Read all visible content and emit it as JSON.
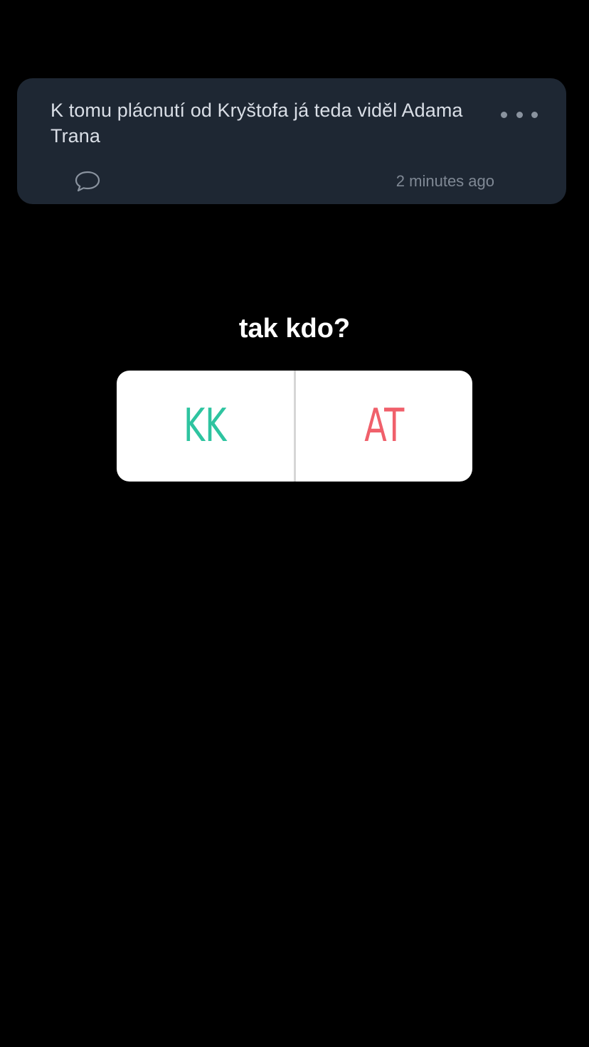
{
  "post": {
    "text": "K tomu plácnutí od Kryštofa já teda viděl Adama Trana",
    "timestamp": "2 minutes ago",
    "icons": {
      "more": "more-horizontal-icon",
      "comment": "comment-bubble-icon"
    }
  },
  "poll": {
    "question": "tak kdo?",
    "options": [
      {
        "label": "KK",
        "color": "#2ec4a0"
      },
      {
        "label": "AT",
        "color": "#f0606b"
      }
    ]
  },
  "colors": {
    "background": "#000000",
    "card": "#1e2733",
    "post_text": "#d9dee6",
    "muted": "#7f8894"
  }
}
